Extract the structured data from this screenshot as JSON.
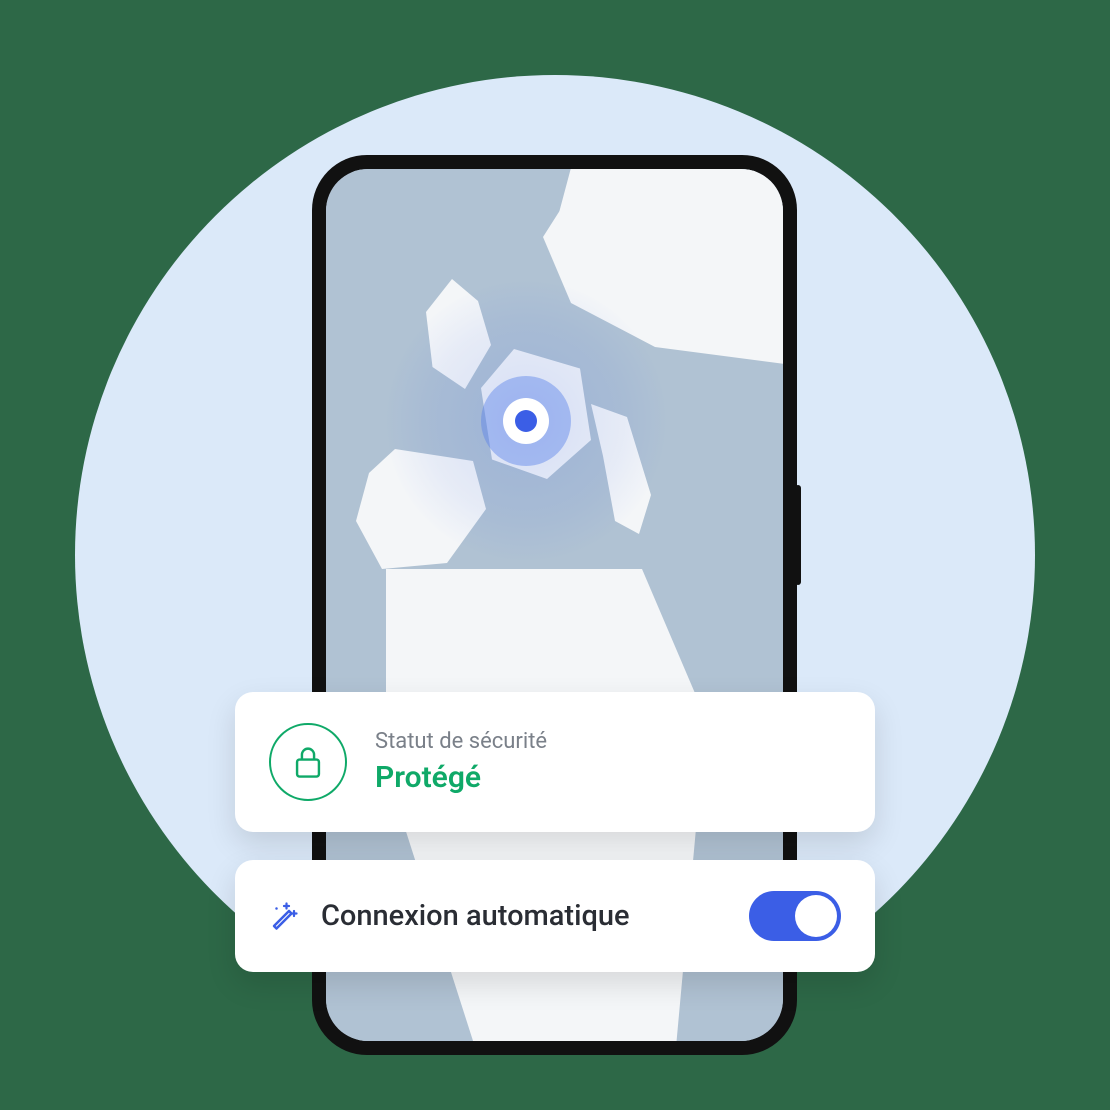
{
  "status": {
    "label": "Statut de sécurité",
    "value": "Protégé"
  },
  "autoConnect": {
    "label": "Connexion automatique",
    "enabled": true
  },
  "colors": {
    "accent": "#3b5ee6",
    "success": "#0fa968",
    "background": "#2d6847",
    "circleBackground": "#dbe9f9"
  }
}
